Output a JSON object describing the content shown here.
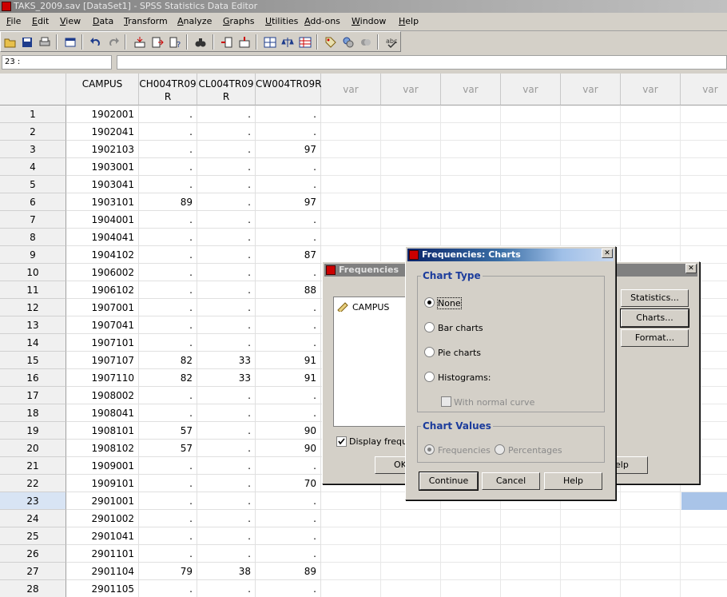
{
  "window": {
    "title": "TAKS_2009.sav [DataSet1] - SPSS Statistics Data Editor"
  },
  "menu": [
    "File",
    "Edit",
    "View",
    "Data",
    "Transform",
    "Analyze",
    "Graphs",
    "Utilities",
    "Add-ons",
    "Window",
    "Help"
  ],
  "toolbar_icons": [
    "open-icon",
    "save-icon",
    "print-icon",
    "dialog-recall-icon",
    "undo-icon",
    "redo-icon",
    "goto-case-icon",
    "goto-variable-icon",
    "variables-icon",
    "find-icon",
    "insert-cases-icon",
    "insert-variable-icon",
    "split-file-icon",
    "weight-cases-icon",
    "select-cases-icon",
    "value-labels-icon",
    "use-sets-icon",
    "show-all-variables-icon",
    "spell-check-icon"
  ],
  "cell_ref": "23 :",
  "cell_value": "",
  "grid": {
    "columns": [
      "CAMPUS",
      "CH004TR09\nR",
      "CL004TR09\nR",
      "CW004TR09R",
      "var",
      "var",
      "var",
      "var",
      "var",
      "var",
      "var"
    ],
    "selected_row": 23,
    "rows": [
      [
        "1",
        "1902001",
        ".",
        ".",
        "."
      ],
      [
        "2",
        "1902041",
        ".",
        ".",
        "."
      ],
      [
        "3",
        "1902103",
        ".",
        ".",
        "97"
      ],
      [
        "4",
        "1903001",
        ".",
        ".",
        "."
      ],
      [
        "5",
        "1903041",
        ".",
        ".",
        "."
      ],
      [
        "6",
        "1903101",
        "89",
        ".",
        "97"
      ],
      [
        "7",
        "1904001",
        ".",
        ".",
        "."
      ],
      [
        "8",
        "1904041",
        ".",
        ".",
        "."
      ],
      [
        "9",
        "1904102",
        ".",
        ".",
        "87"
      ],
      [
        "10",
        "1906002",
        ".",
        ".",
        "."
      ],
      [
        "11",
        "1906102",
        ".",
        ".",
        "88"
      ],
      [
        "12",
        "1907001",
        ".",
        ".",
        "."
      ],
      [
        "13",
        "1907041",
        ".",
        ".",
        "."
      ],
      [
        "14",
        "1907101",
        ".",
        ".",
        "."
      ],
      [
        "15",
        "1907107",
        "82",
        "33",
        "91"
      ],
      [
        "16",
        "1907110",
        "82",
        "33",
        "91"
      ],
      [
        "17",
        "1908002",
        ".",
        ".",
        "."
      ],
      [
        "18",
        "1908041",
        ".",
        ".",
        "."
      ],
      [
        "19",
        "1908101",
        "57",
        ".",
        "90"
      ],
      [
        "20",
        "1908102",
        "57",
        ".",
        "90"
      ],
      [
        "21",
        "1909001",
        ".",
        ".",
        "."
      ],
      [
        "22",
        "1909101",
        ".",
        ".",
        "70"
      ],
      [
        "23",
        "2901001",
        ".",
        ".",
        "."
      ],
      [
        "24",
        "2901002",
        ".",
        ".",
        "."
      ],
      [
        "25",
        "2901041",
        ".",
        ".",
        "."
      ],
      [
        "26",
        "2901101",
        ".",
        ".",
        "."
      ],
      [
        "27",
        "2901104",
        "79",
        "38",
        "89"
      ],
      [
        "28",
        "2901105",
        ".",
        ".",
        "."
      ]
    ]
  },
  "frequencies_dialog": {
    "title": "Frequencies",
    "variable_list": [
      "CAMPUS"
    ],
    "buttons": [
      "Statistics...",
      "Charts...",
      "Format..."
    ],
    "display_tables_label": "Display freque",
    "ok_label": "OK",
    "help_label": "elp"
  },
  "charts_dialog": {
    "title": "Frequencies: Charts",
    "chart_type_label": "Chart Type",
    "chart_types": [
      "None",
      "Bar charts",
      "Pie charts",
      "Histograms:"
    ],
    "selected_chart_type": "None",
    "normal_curve_label": "With normal curve",
    "chart_values_label": "Chart Values",
    "chart_values": [
      "Frequencies",
      "Percentages"
    ],
    "continue_label": "Continue",
    "cancel_label": "Cancel",
    "help_label": "Help"
  },
  "colors": {
    "title_active": "#0a246a",
    "title_inactive": "#808080",
    "selected_cell": "#a9c4e8"
  }
}
